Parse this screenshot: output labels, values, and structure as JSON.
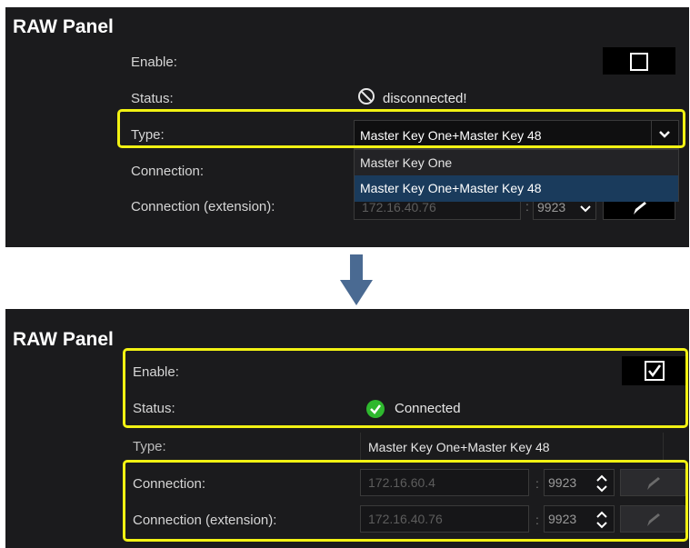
{
  "top_panel": {
    "title": "RAW Panel",
    "enable_label": "Enable:",
    "status_label": "Status:",
    "status_text": "disconnected!",
    "type_label": "Type:",
    "type_value": "Master Key One+Master Key 48",
    "dropdown_options": [
      "Master Key One",
      "Master Key One+Master Key 48"
    ],
    "connection_label": "Connection:",
    "connection_ext_label": "Connection (extension):",
    "connection_ext_ip": "172.16.40.76",
    "connection_ext_port": "9923",
    "enable_checked": false
  },
  "bottom_panel": {
    "title": "RAW Panel",
    "enable_label": "Enable:",
    "status_label": "Status:",
    "status_text": "Connected",
    "type_label": "Type:",
    "type_value": "Master Key One+Master Key 48",
    "connection_label": "Connection:",
    "connection_ip": "172.16.60.4",
    "connection_port": "9923",
    "connection_ext_label": "Connection (extension):",
    "connection_ext_ip": "172.16.40.76",
    "connection_ext_port": "9923",
    "enable_checked": true
  },
  "colon": ":",
  "colors": {
    "highlight": "#f2f213",
    "arrow": "#4a6a92",
    "connected": "#2eb82e",
    "dropdown_selected": "#1a3b5c"
  }
}
